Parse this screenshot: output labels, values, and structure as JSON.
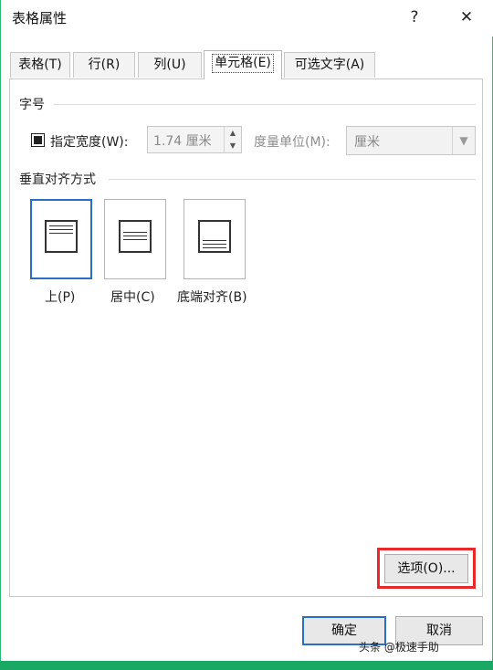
{
  "window": {
    "title": "表格属性",
    "help_label": "?",
    "close_label": "✕"
  },
  "tabs": [
    {
      "label": "表格(T)",
      "active": false
    },
    {
      "label": "行(R)",
      "active": false
    },
    {
      "label": "列(U)",
      "active": false
    },
    {
      "label": "单元格(E)",
      "active": true
    },
    {
      "label": "可选文字(A)",
      "active": false
    }
  ],
  "size_section": {
    "label": "字号",
    "specify_width_label": "指定宽度(W):",
    "specify_width_checked": true,
    "width_value": "1.74 厘米",
    "unit_label": "度量单位(M):",
    "unit_value": "厘米"
  },
  "valign_section": {
    "label": "垂直对齐方式",
    "options": [
      {
        "label": "上(P)",
        "selected": true
      },
      {
        "label": "居中(C)",
        "selected": false
      },
      {
        "label": "底端对齐(B)",
        "selected": false
      }
    ]
  },
  "options_button_label": "选项(O)...",
  "ok_label": "确定",
  "cancel_label": "取消",
  "watermark_text": "头条 @极速手助",
  "colors": {
    "accent": "#2a6fc4",
    "highlight": "#e8292c",
    "frame": "#1aa865"
  }
}
